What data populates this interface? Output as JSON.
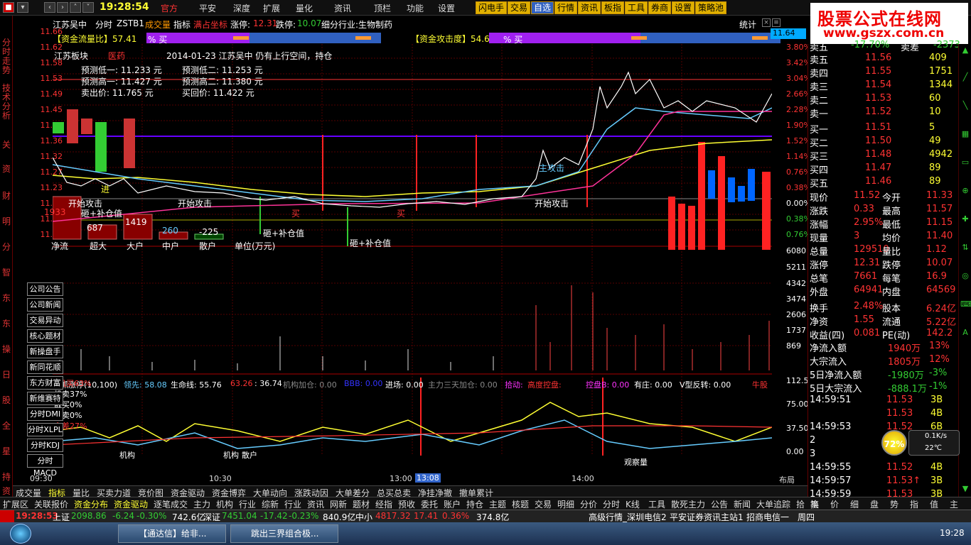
{
  "topbar": {
    "time": "19:28:54",
    "menus": [
      "官方",
      "平安",
      "深度",
      "扩展",
      "量化",
      "资讯",
      "顶栏",
      "功能",
      "设置"
    ],
    "tools": [
      "闪电手",
      "交易",
      "自选",
      "行情",
      "资讯",
      "板指",
      "工具",
      "券商",
      "设置",
      "策略池"
    ]
  },
  "logo": {
    "line1": "股票公式在线网",
    "line2": "www.gszx.com.cn"
  },
  "lefttabs": [
    "分时走势",
    "技术分析",
    "关",
    "资",
    "财",
    "明",
    "分",
    "智",
    "东",
    "东",
    "操",
    "日",
    "股",
    "全",
    "星",
    "持",
    "资"
  ],
  "header": {
    "stock": "江苏吴中",
    "mode": "分时",
    "code": "ZSTB1",
    "t1": "成交量",
    "t2": "指标",
    "t3": "满占坐标",
    "zt_label": "涨停:",
    "zt": "12.31",
    "dt_label": "跌停:",
    "dt": "10.07",
    "industry": "细分行业:生物制药",
    "stat": "统计"
  },
  "bars": {
    "flow_label": "【资金流量比】57.41",
    "flow_suffix": "% 买",
    "attack_label": "【资金攻击度】54.67",
    "attack_suffix": "% 买"
  },
  "info": {
    "block": "江苏板块",
    "sector": "医药",
    "note": "2014-01-23 江苏吴中 仍有上行空间，持仓",
    "p1": "预测低一:",
    "v1": "11.233",
    "p2": "预测低二:",
    "v2": "11.253",
    "p3": "预测高一:",
    "v3": "11.427",
    "p4": "预测高二:",
    "v4": "11.380",
    "p5": "卖出价:",
    "v5": "11.765",
    "p6": "买回价:",
    "v6": "11.422",
    "unit": "元"
  },
  "labels": {
    "attack": "开始攻击",
    "plus": "砸+补仓值",
    "buy": "买",
    "zhu": "主攻击",
    "flow": "净流",
    "super": "超大",
    "big": "大户",
    "mid": "中户",
    "retail": "散户",
    "unitw": "单位(万元)",
    "l687": "687",
    "l1419": "1419",
    "l260": "260",
    "l225": "-225",
    "l1933": "1933",
    "lenter": "进"
  },
  "axis_left": [
    "11.66",
    "11.62",
    "11.58",
    "11.53",
    "11.49",
    "11.45",
    "11.40",
    "11.36",
    "11.32",
    "11.27",
    "11.23",
    "11.19",
    "11.14",
    "11.10"
  ],
  "axis_right": [
    "3.80%",
    "3.42%",
    "3.04%",
    "2.66%",
    "2.28%",
    "1.90%",
    "1.52%",
    "1.14%",
    "0.76%",
    "0.38%",
    "0.00%",
    "0.38%",
    "0.76%"
  ],
  "cur_price": "11.64",
  "vol_axis": [
    "6080",
    "5211",
    "4342",
    "3474",
    "2606",
    "1737",
    "869"
  ],
  "ind_axis": [
    "112.50",
    "75.00",
    "37.50",
    "0.00"
  ],
  "indicator": {
    "name": "乱抓涨停(10,100)",
    "i1": "领先: 58.08",
    "i2": "生命线: 55.76",
    "i3": "63.26",
    "i4": ": 36.74",
    "i5": "机构加仓: 0.00",
    "i6": "BBB: 0.00",
    "i7": "进场: 0.00",
    "i8": "主力三天加仓: 0.00",
    "i9": "拾动:",
    "i10": "高度控盘:",
    "i11": "控盘B: 0.00",
    "i12": "有庄: 0.00",
    "i13": "V型反转: 0.00",
    "i14": "牛股"
  },
  "ind_labels": {
    "a": "机买63%",
    "b": "机卖37%",
    "c": "散买0%",
    "d": "散卖0%",
    "e": "主差27%",
    "f": "机构",
    "g": "散户",
    "h": "观察量"
  },
  "side_buttons": [
    "公司公告",
    "公司新闻",
    "交易异动",
    "核心题材",
    "新操盘手",
    "新同花顺",
    "东方财富",
    "新维赛特",
    "分时DMI",
    "分时XLPL",
    "分时KDJ",
    "分时MACD"
  ],
  "time_axis": [
    "09:30",
    "10:30",
    "13:00",
    "13:08",
    "14:00",
    "布局"
  ],
  "quote": {
    "asks": [
      [
        "卖五",
        "11.56",
        "409"
      ],
      [
        "卖四",
        "11.55",
        "1751"
      ],
      [
        "卖三",
        "11.54",
        "1344"
      ],
      [
        "卖二",
        "11.53",
        "60"
      ],
      [
        "卖一",
        "11.52",
        "10"
      ]
    ],
    "bids": [
      [
        "买一",
        "11.51",
        "5"
      ],
      [
        "买二",
        "11.50",
        "49"
      ],
      [
        "买三",
        "11.48",
        "4942"
      ],
      [
        "买四",
        "11.47",
        "89"
      ],
      [
        "买五",
        "11.46",
        "89"
      ]
    ],
    "stats": [
      [
        "现价",
        "11.52",
        "今开",
        "11.33"
      ],
      [
        "涨跌",
        "0.33",
        "最高",
        "11.57"
      ],
      [
        "涨幅",
        "2.95%",
        "最低",
        "11.15"
      ],
      [
        "现量",
        "3",
        "均价",
        "11.40"
      ],
      [
        "总量",
        "129510",
        "量比",
        "1.12"
      ],
      [
        "涨停",
        "12.31",
        "跌停",
        "10.07"
      ],
      [
        "总笔",
        "7661",
        "每笔",
        "16.9"
      ],
      [
        "外盘",
        "64941",
        "内盘",
        "64569"
      ],
      [
        "换手",
        "2.48%",
        "股本",
        "6.24亿"
      ],
      [
        "净资",
        "1.55",
        "流通",
        "5.22亿"
      ],
      [
        "收益(四)",
        "0.081",
        "PE(动)",
        "142.2"
      ]
    ],
    "flows": [
      [
        "净流入额",
        "1940万",
        "13%"
      ],
      [
        "大宗流入",
        "1805万",
        "12%"
      ],
      [
        "5日净流入额",
        "-1980万",
        "-3%"
      ],
      [
        "5日大宗流入",
        "-888.1万",
        "-1%"
      ]
    ],
    "ticks": [
      [
        "14:59:51",
        "11.53",
        "3B"
      ],
      [
        "",
        "11.53",
        "4B"
      ],
      [
        "14:59:53",
        "11.52",
        "6B"
      ],
      [
        "2",
        "",
        ""
      ],
      [
        "3",
        "",
        ""
      ],
      [
        "14:59:55",
        "11.52",
        "4B"
      ],
      [
        "14:59:57",
        "11.53↑",
        "3B"
      ],
      [
        "14:59:59",
        "11.53",
        "3B"
      ]
    ],
    "top_partial": [
      "卖五",
      "-17.70%",
      "卖差",
      "-2373"
    ]
  },
  "gauge": {
    "pct": "72%",
    "speed": "0.1K/s",
    "temp": "22℃"
  },
  "scrollbar": [
    "笔",
    "价",
    "细",
    "盘",
    "势",
    "指",
    "值",
    "主"
  ],
  "bottom1": [
    "成交量",
    "指标",
    "量比",
    "买卖力道",
    "竞价图",
    "资金驱动",
    "资金博弈",
    "大单动向",
    "涨跌动因",
    "大单差分",
    "总买总卖",
    "净挂净撤",
    "撤单累计"
  ],
  "bottom2": [
    "扩展区",
    "关联报价",
    "资金分布",
    "资金驱动",
    "逐笔成交",
    "主力",
    "机构",
    "行业",
    "综新",
    "行业",
    "资讯",
    "网新",
    "题材",
    "经指",
    "预收",
    "委托",
    "账户",
    "持仓",
    "主题",
    "核题",
    "交易",
    "明细",
    "分价",
    "分时",
    "K线",
    "工具",
    "散死主力",
    "公告",
    "新闻",
    "大单追踪",
    "拾",
    "换"
  ],
  "status": {
    "time": "19:28:53",
    "sh": "上证",
    "shv": "2098.86",
    "shc": "-6.24",
    "shp": "-0.30%",
    "sha": "742.6亿",
    "sz": "深证",
    "szv": "7451.04",
    "szc": "-17.42",
    "szp": "-0.23%",
    "sza": "840.9亿",
    "zx": "中小",
    "zxv": "4817.32",
    "zxc": "17.41",
    "zxp": "0.36%",
    "zxa": "374.8亿",
    "r1": "高级行情_深圳电信2",
    "r2": "平安证券资讯主站1",
    "r3": "招商电信一",
    "r4": "周四"
  },
  "taskbar": {
    "t1": "【通达信】给非...",
    "t2": "跳出三界组合极...",
    "clock": "19:28"
  }
}
